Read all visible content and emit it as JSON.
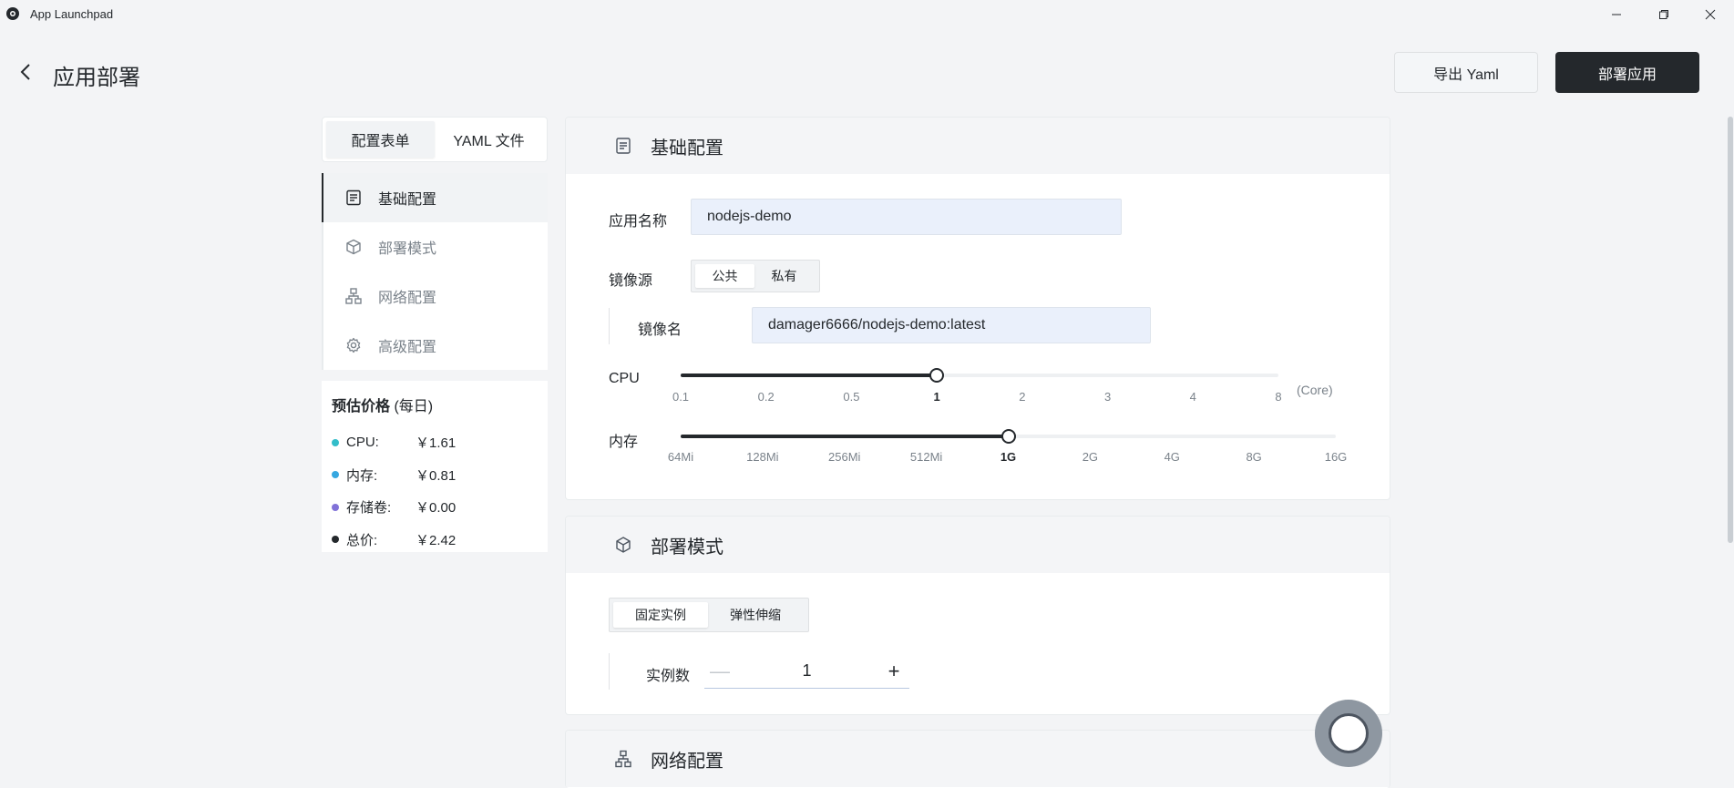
{
  "window": {
    "title": "App Launchpad",
    "controls": [
      "minimize-icon",
      "restore-icon",
      "close-icon"
    ]
  },
  "header": {
    "title": "应用部署",
    "export_label": "导出 Yaml",
    "deploy_label": "部署应用"
  },
  "tabs": [
    {
      "label": "配置表单",
      "active": true
    },
    {
      "label": "YAML 文件",
      "active": false
    }
  ],
  "nav": [
    {
      "label": "基础配置",
      "icon": "document-icon",
      "active": true
    },
    {
      "label": "部署模式",
      "icon": "cube-icon",
      "active": false
    },
    {
      "label": "网络配置",
      "icon": "network-icon",
      "active": false
    },
    {
      "label": "高级配置",
      "icon": "gear-icon",
      "active": false
    }
  ],
  "price": {
    "title": "预估价格",
    "subtitle": "(每日)",
    "items": [
      {
        "label": "CPU:",
        "value": "￥1.61",
        "color": "#33bdc9"
      },
      {
        "label": "内存:",
        "value": "￥0.81",
        "color": "#36a7e0"
      },
      {
        "label": "存储卷:",
        "value": "￥0.00",
        "color": "#8172d8"
      },
      {
        "label": "总价:",
        "value": "￥2.42",
        "color": "#24282c"
      }
    ]
  },
  "basic": {
    "title": "基础配置",
    "app_name_label": "应用名称",
    "app_name_value": "nodejs-demo",
    "image_source_label": "镜像源",
    "image_source_options": [
      "公共",
      "私有"
    ],
    "image_source_selected": "公共",
    "image_name_label": "镜像名",
    "image_name_value": "damager6666/nodejs-demo:latest",
    "cpu": {
      "label": "CPU",
      "ticks": [
        "0.1",
        "0.2",
        "0.5",
        "1",
        "2",
        "3",
        "4",
        "8"
      ],
      "selected": "1",
      "selected_fraction": 0.4286,
      "unit": "(Core)"
    },
    "memory": {
      "label": "内存",
      "ticks": [
        "64Mi",
        "128Mi",
        "256Mi",
        "512Mi",
        "1G",
        "2G",
        "4G",
        "8G",
        "16G"
      ],
      "selected": "1G",
      "selected_fraction": 0.5
    }
  },
  "deploy_mode": {
    "title": "部署模式",
    "options": [
      "固定实例",
      "弹性伸缩"
    ],
    "selected": "固定实例",
    "instance_label": "实例数",
    "instance_minus": "—",
    "instance_value": "1",
    "instance_plus": "+"
  },
  "network": {
    "title": "网络配置"
  }
}
